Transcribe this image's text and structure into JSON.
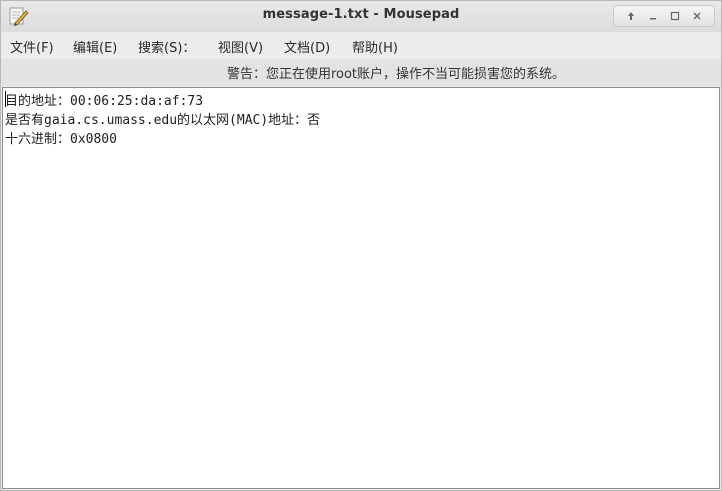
{
  "window": {
    "title": "message-1.txt - Mousepad"
  },
  "menubar": {
    "items": [
      {
        "label": "文件(F)"
      },
      {
        "label": "编辑(E)"
      },
      {
        "label": "搜索(S)："
      },
      {
        "label": "视图(V)"
      },
      {
        "label": "文档(D)"
      },
      {
        "label": "帮助(H)"
      }
    ]
  },
  "warning": {
    "text": "警告：您正在使用root账户，操作不当可能损害您的系统。"
  },
  "editor": {
    "lines": [
      "目的地址：00:06:25:da:af:73",
      "是否有gaia.cs.umass.edu的以太网(MAC)地址：否",
      "十六进制：0x0800"
    ]
  },
  "window_controls": {
    "icons": [
      "up-arrow-icon",
      "minimize-icon",
      "maximize-icon",
      "close-icon"
    ]
  }
}
